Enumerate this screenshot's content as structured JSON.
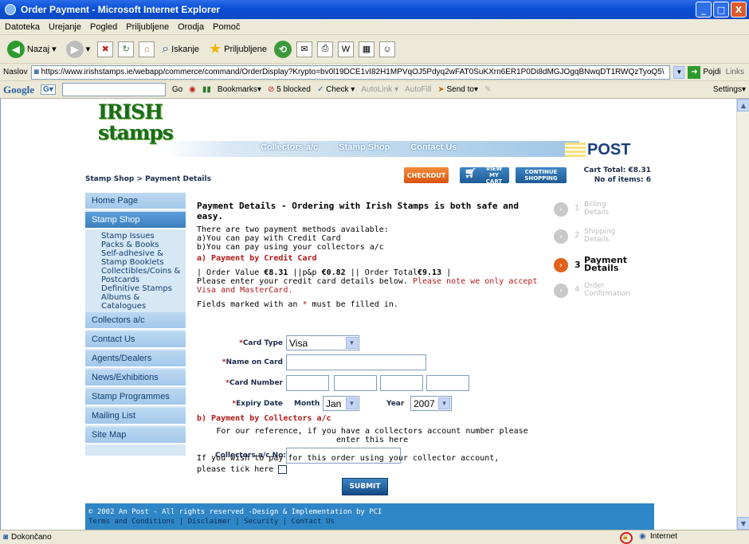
{
  "window": {
    "title": "Order Payment - Microsoft Internet Explorer",
    "buttons": [
      "_",
      "□",
      "X"
    ]
  },
  "menu": [
    "Datoteka",
    "Urejanje",
    "Pogled",
    "Priljubljene",
    "Orodja",
    "Pomoč"
  ],
  "toolbar": {
    "back": "Nazaj",
    "search": "Iskanje",
    "favorites": "Priljubljene"
  },
  "address": {
    "label": "Naslov",
    "url": "https://www.irishstamps.ie/webapp/commerce/command/OrderDisplay?Krypto=bv0l19DCE1vI82H1MPVqOJ5Pdyq2wFAT0SuKXrn6ER1P0Di8dMGJOgqBNwqDT1RWQzTyoQ5\\",
    "go": "Pojdi",
    "links": "Links"
  },
  "googlebar": {
    "brand": "Google",
    "go": "Go",
    "bookmarks": "Bookmarks▾",
    "blocked": "5 blocked",
    "check": "Check ▾",
    "autolink": "AutoLink ▾",
    "autofill": "AutoFill",
    "sendto": "Send to▾",
    "settings": "Settings▾"
  },
  "site": {
    "logo1": "IRISH",
    "logo2": "stamps",
    "nav": [
      "Collectors a/c",
      "Stamp Shop",
      "Contact Us"
    ],
    "post": "POST",
    "breadcrumb": "Stamp Shop > Payment Details",
    "checkout": "CHECKOUT",
    "view_cart": "VIEW MY CART",
    "continue": "CONTINUE SHOPPING",
    "cart_total": "Cart Total: €8.31",
    "items": "No of items: 6"
  },
  "sidebar": {
    "items": [
      "Home Page",
      "Stamp Shop",
      "Collectors a/c",
      "Contact Us",
      "Agents/Dealers",
      "News/Exhibitions",
      "Stamp Programmes",
      "Mailing List",
      "Site Map"
    ],
    "sub": [
      "Stamp Issues",
      "Packs & Books",
      "Self-adhesive &",
      "Stamp Booklets",
      "Collectibles/Coins &",
      "Postcards",
      "Definitive Stamps",
      "Albums &",
      "Catalogues"
    ]
  },
  "main": {
    "title": "Payment Details - Ordering with Irish Stamps is both safe and easy.",
    "intro1": "There are two payment methods available:",
    "intro2": "a)You can pay with Credit Card",
    "intro3": "b)You can pay using your collectors a/c",
    "sectA": "a) Payment by Credit Card",
    "order_pre": "| Order Value ",
    "order_val": "€8.31",
    "order_mid": " ||p&p ",
    "pp": "€0.82",
    "order_mid2": " || Order Total",
    "total": "€9.13",
    "order_end": " |",
    "enter": "Please enter your credit card details below. ",
    "note": "Please note we only accept Visa and MasterCard.",
    "fields_pre": "Fields marked with an ",
    "fields_post": " must be filled in.",
    "card_type": "Card Type",
    "card_type_val": "Visa",
    "name_on_card": "Name on Card",
    "card_number": "Card Number",
    "expiry": "Expiry Date",
    "month": "Month",
    "month_val": "Jan",
    "year": "Year",
    "year_val": "2007",
    "sectB": "b) Payment by Collectors a/c",
    "ref": "For our reference, if you have a collectors account number please enter this here",
    "collectors_no": "Collectors a/c No:",
    "tick": "If you wish to pay for this order using your collector account, please tick here",
    "submit": "SUBMIT"
  },
  "steps": [
    {
      "num": "1",
      "label": "Billing Details",
      "active": false
    },
    {
      "num": "2",
      "label": "Shipping Details",
      "active": false
    },
    {
      "num": "3",
      "label": "Payment Details",
      "active": true
    },
    {
      "num": "4",
      "label": "Order Confirmation",
      "active": false
    }
  ],
  "footer": {
    "line1": "© 2002 An Post - All rights reserved -Design & Implementation by PCI",
    "line2": "Terms and Conditions | Disclaimer | Security | Contact Us"
  },
  "status": {
    "left": "Dokončano",
    "zone": "Internet"
  }
}
